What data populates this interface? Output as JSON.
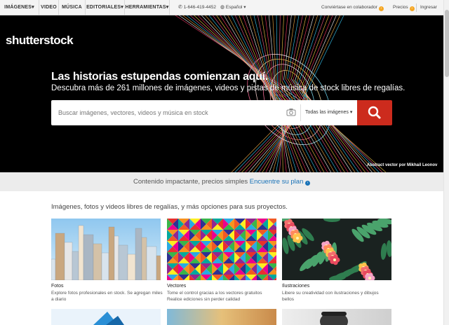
{
  "topnav": {
    "items": [
      "IMÁGENES▾",
      "VIDEO",
      "MÚSICA",
      "EDITORIALES▾",
      "HERRAMIENTAS▾"
    ],
    "phone": "1-646-419-4452",
    "language": "Español ▾",
    "contributor": "Conviértase en colaborador",
    "pricing": "Precios",
    "login": "Ingresar"
  },
  "hero": {
    "logo": "shutterstock",
    "headline": "Las historias estupendas comienzan aquí.",
    "subline": "Descubra más de 261 millones de imágenes, videos y pistas de música de stock libres de regalías.",
    "search_placeholder": "Buscar imágenes, vectores, videos y música en stock",
    "search_type": "Todas las imágenes ▾",
    "credit": "Abstract vector por Mikhail Leonov"
  },
  "promo": {
    "text": "Contenido impactante, precios simples",
    "link": "Encuentre su plan"
  },
  "intro": "Imágenes, fotos y videos libres de regalías, y más opciones para sus proyectos.",
  "cards": [
    {
      "title": "Fotos",
      "desc": "Explore fotos profesionales en stock. Se agregan miles a diario"
    },
    {
      "title": "Vectores",
      "desc": "Tome el control gracias a los vectores gratuitos Realice ediciones sin perder calidad"
    },
    {
      "title": "Ilustraciones",
      "desc": "Libere su creatividad con ilustraciones y dibujos bellos"
    }
  ],
  "colors": {
    "accent_red": "#cc2b1d",
    "link_blue": "#1a73b8",
    "badge_orange": "#f5a623"
  }
}
